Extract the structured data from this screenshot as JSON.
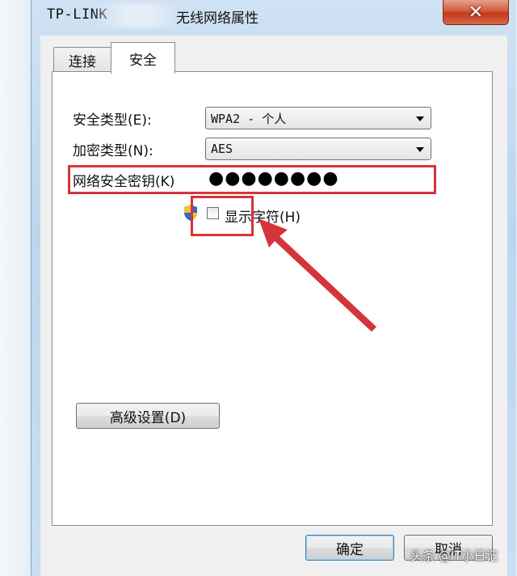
{
  "window": {
    "title_prefix": "TP-LINK",
    "title_suffix": "无线网络属性",
    "close_label": "✕"
  },
  "tabs": [
    {
      "label": "连接",
      "selected": false
    },
    {
      "label": "安全",
      "selected": true
    }
  ],
  "form": {
    "security_type_label": "安全类型(E):",
    "security_type_value": "WPA2 - 个人",
    "encryption_type_label": "加密类型(N):",
    "encryption_type_value": "AES",
    "key_label": "网络安全密钥(K)",
    "key_value": "●●●●●●●●",
    "show_chars_label": "显示字符(H)",
    "show_chars_checked": false
  },
  "buttons": {
    "advanced": "高级设置(D)",
    "ok": "确定",
    "cancel": "取消"
  },
  "watermark": "头条 @IT小日记",
  "colors": {
    "highlight": "#d4343a",
    "frame": "#bcd6ee"
  }
}
